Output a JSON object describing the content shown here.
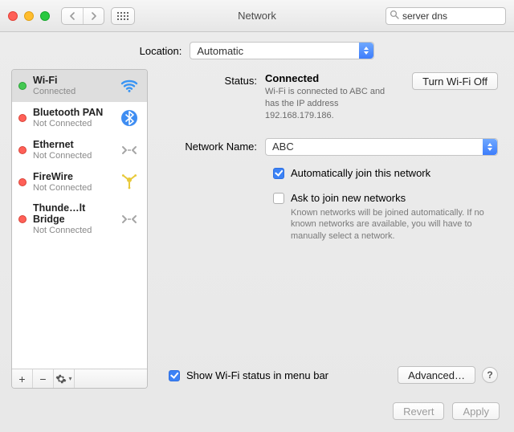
{
  "window": {
    "title": "Network"
  },
  "search": {
    "value": "server dns",
    "icon": "search-icon",
    "clear_icon": "clear-icon"
  },
  "location": {
    "label": "Location:",
    "value": "Automatic"
  },
  "sidebar": {
    "items": [
      {
        "name": "Wi-Fi",
        "status": "Connected",
        "dot": "green",
        "icon": "wifi-icon"
      },
      {
        "name": "Bluetooth PAN",
        "status": "Not Connected",
        "dot": "red",
        "icon": "bluetooth-icon"
      },
      {
        "name": "Ethernet",
        "status": "Not Connected",
        "dot": "red",
        "icon": "ethernet-icon"
      },
      {
        "name": "FireWire",
        "status": "Not Connected",
        "dot": "red",
        "icon": "firewire-icon"
      },
      {
        "name": "Thunde…lt Bridge",
        "status": "Not Connected",
        "dot": "red",
        "icon": "thunderbolt-icon"
      }
    ],
    "footer": {
      "add": "+",
      "remove": "−",
      "gear": "gear-icon"
    }
  },
  "detail": {
    "status_label": "Status:",
    "status_value": "Connected",
    "turn_off": "Turn Wi-Fi Off",
    "status_sub": "Wi-Fi is connected to ABC and has the IP address 192.168.179.186.",
    "network_name_label": "Network Name:",
    "network_name_value": "ABC",
    "auto_join": "Automatically join this network",
    "ask_join": "Ask to join new networks",
    "ask_sub": "Known networks will be joined automatically. If no known networks are available, you will have to manually select a network.",
    "show_status": "Show Wi-Fi status in menu bar",
    "advanced": "Advanced…",
    "help": "?"
  },
  "footer": {
    "revert": "Revert",
    "apply": "Apply"
  },
  "checks": {
    "auto_join": true,
    "ask_join": false,
    "show_status": true
  }
}
